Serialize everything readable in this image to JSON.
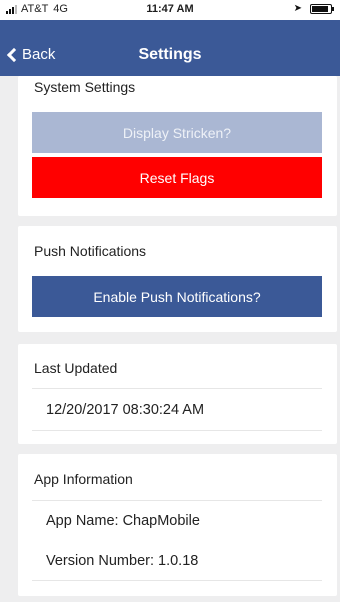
{
  "status": {
    "carrier": "AT&T",
    "network": "4G",
    "time": "11:47 AM"
  },
  "navbar": {
    "back_label": "Back",
    "title": "Settings"
  },
  "system": {
    "heading": "System Settings",
    "display_stricken_label": "Display Stricken?",
    "reset_flags_label": "Reset Flags"
  },
  "push": {
    "heading": "Push Notifications",
    "enable_label": "Enable Push Notifications?"
  },
  "last_updated": {
    "heading": "Last Updated",
    "value": "12/20/2017 08:30:24 AM"
  },
  "app_info": {
    "heading": "App Information",
    "app_name": "App Name: ChapMobile",
    "version": "Version Number: 1.0.18"
  },
  "colors": {
    "navbar": "#3b5997",
    "disabled_button": "#aab7d3",
    "danger_button": "#ff0000",
    "primary_button": "#3b5997",
    "background": "#eeeeef"
  }
}
